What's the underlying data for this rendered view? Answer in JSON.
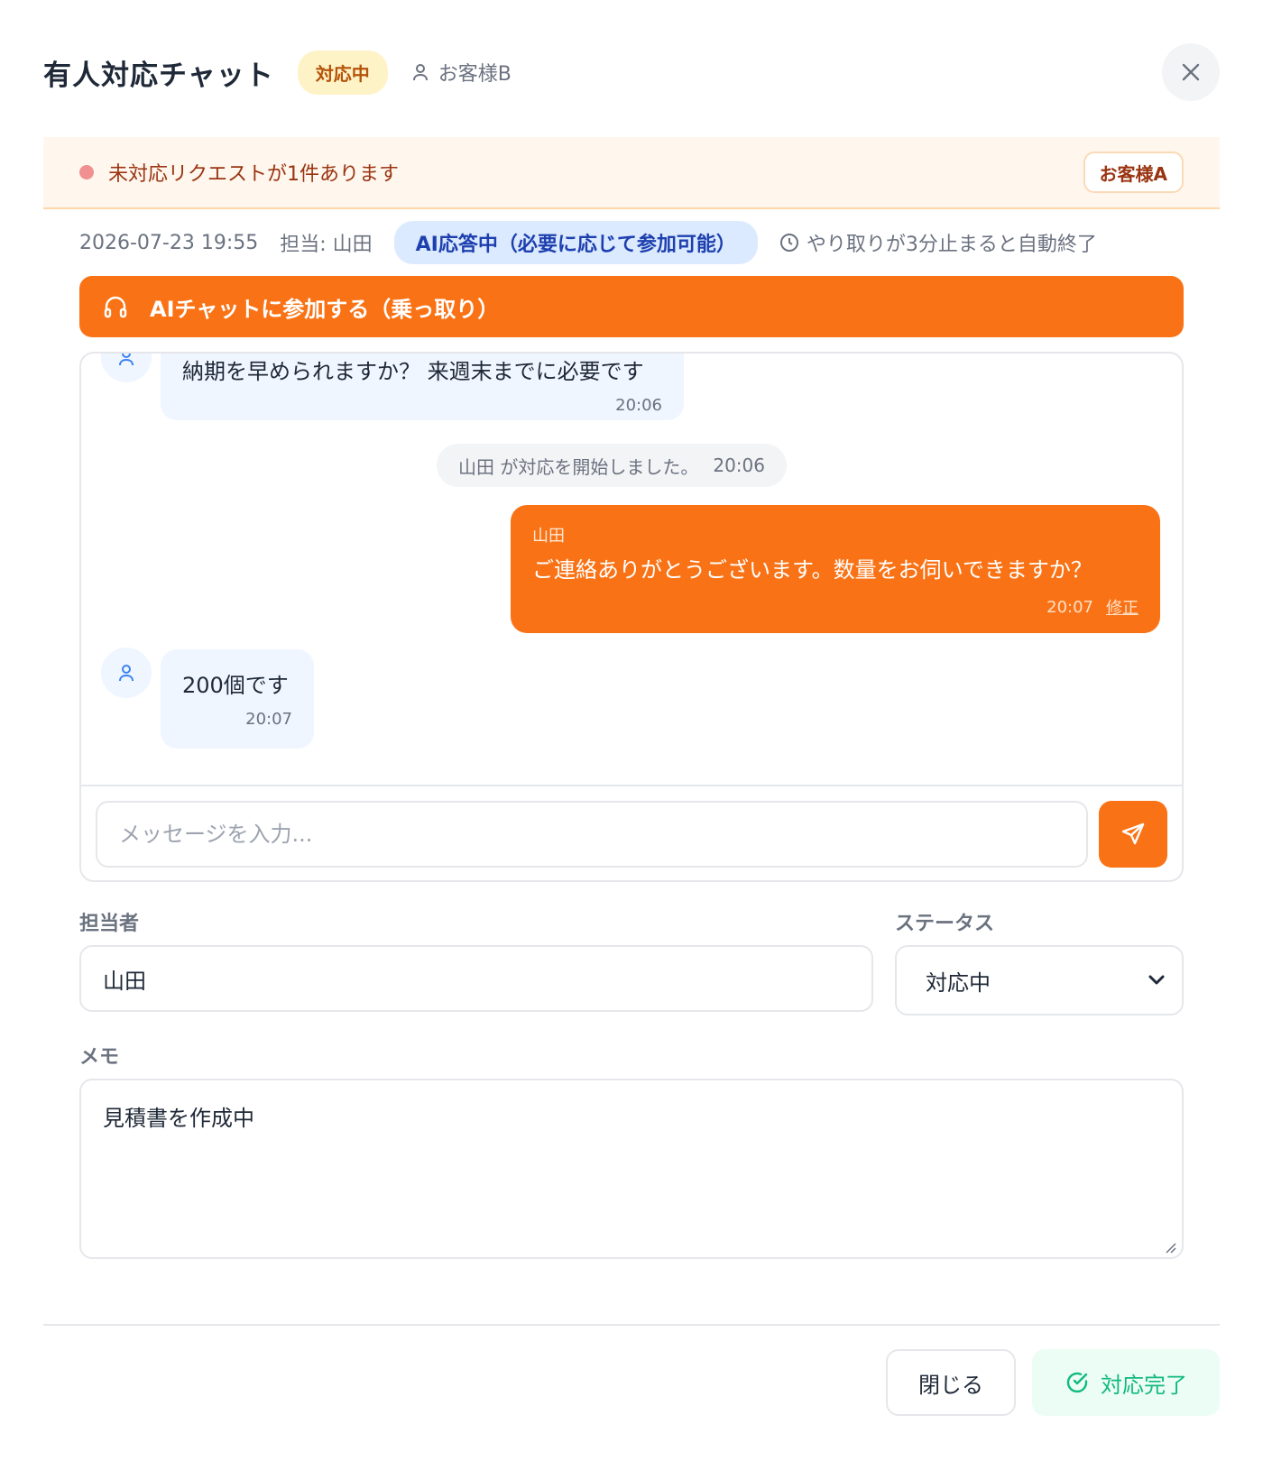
{
  "header": {
    "title": "有人対応チャット",
    "status": "対応中",
    "customer": "お客様B"
  },
  "alert": {
    "text": "未対応リクエストが1件あります",
    "chip": "お客様A"
  },
  "meta": {
    "datetime": "2026-07-23 19:55",
    "assignee": "担当: 山田",
    "ai_status": "AI応答中（必要に応じて参加可能）",
    "auto_end": "やり取りが3分止まると自動終了"
  },
  "join_button": "AIチャットに参加する（乗っ取り）",
  "messages": [
    {
      "type": "customer",
      "text": "納期を早められますか？ 来週末までに必要です",
      "time": "20:06"
    },
    {
      "type": "system",
      "text": "山田 が対応を開始しました。",
      "time": "20:06"
    },
    {
      "type": "agent",
      "sender": "山田",
      "text": "ご連絡ありがとうございます。数量をお伺いできますか？",
      "time": "20:07",
      "edit": "修正"
    },
    {
      "type": "customer",
      "text": "200個です",
      "time": "20:07"
    }
  ],
  "chat_input": {
    "placeholder": "メッセージを入力..."
  },
  "form": {
    "assignee_label": "担当者",
    "assignee_value": "山田",
    "status_label": "ステータス",
    "status_value": "対応中",
    "memo_label": "メモ",
    "memo_value": "見積書を作成中"
  },
  "footer": {
    "close": "閉じる",
    "complete": "対応完了"
  },
  "colors": {
    "accent": "#f97316",
    "success": "#10b981",
    "info_bg": "#dbeafe"
  }
}
